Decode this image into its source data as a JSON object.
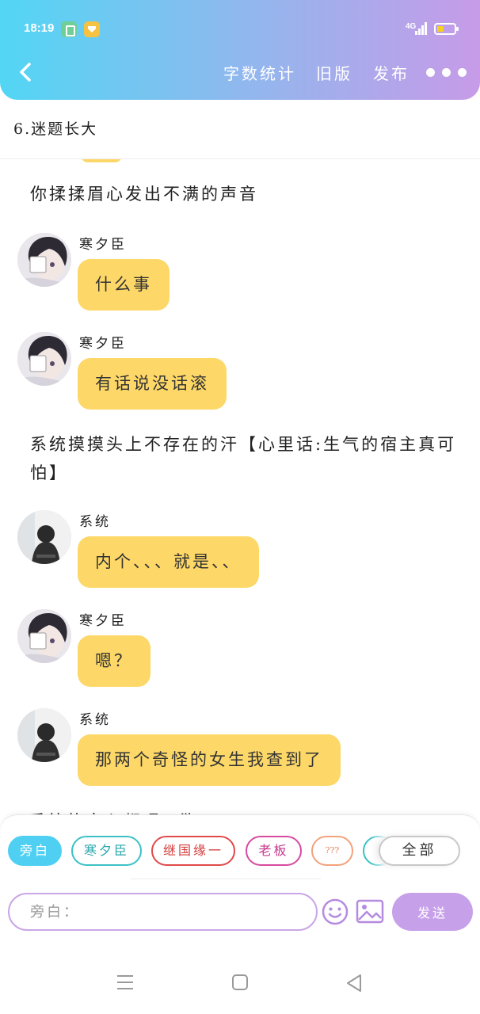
{
  "status_bar": {
    "time": "18:19",
    "network": "4G",
    "battery_level": 0.3,
    "accent_battery": "#f5d020"
  },
  "header": {
    "back_icon": "chevron-left-icon",
    "actions": [
      "字数统计",
      "旧版",
      "发布"
    ],
    "more_icon": "three-dots-icon",
    "gradient": [
      "#52d6f4",
      "#c79be8"
    ]
  },
  "chapter": {
    "title": "6.迷题长大"
  },
  "chat": {
    "bubble_color": "#fdd868",
    "narration_1": "你揉揉眉心发出不满的声音",
    "narration_2": "系统摸摸头上不存在的汗【心里话:生气的宿主真可怕】",
    "messages": [
      {
        "speaker": "寒夕臣",
        "text": "什么事",
        "avatar": "anime-boy-avatar"
      },
      {
        "speaker": "寒夕臣",
        "text": "有话说没话滚",
        "avatar": "anime-boy-avatar"
      },
      {
        "speaker": "系统",
        "text": "内个、、、就是、、",
        "avatar": "system-avatar"
      },
      {
        "speaker": "寒夕臣",
        "text": "嗯？",
        "avatar": "anime-boy-avatar"
      },
      {
        "speaker": "系统",
        "text": "那两个奇怪的女生我查到了",
        "avatar": "system-avatar"
      }
    ],
    "cut_line": "系统的良心都喂了狗"
  },
  "composer": {
    "roles": [
      "旁白",
      "寒夕臣",
      "继国缘一",
      "老板",
      "???"
    ],
    "active_role": "旁白",
    "all_label": "全部",
    "placeholder": "旁白：",
    "send_label": "发送",
    "emoji_icon": "smiley-icon",
    "image_icon": "image-icon",
    "accent": "#c7a0ea",
    "active_color": "#4fd0f2"
  },
  "system_nav": {
    "icons": [
      "menu-icon",
      "home-square-icon",
      "back-triangle-icon"
    ]
  }
}
